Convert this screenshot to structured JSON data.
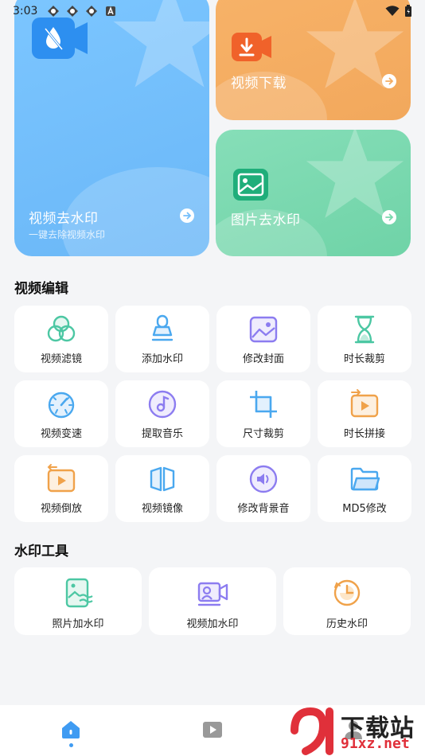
{
  "status_bar": {
    "time": "3:03"
  },
  "cards": {
    "video_remove": {
      "title": "视频去水印",
      "subtitle": "一键去除视频水印"
    },
    "video_download": {
      "title": "视频下载"
    },
    "image_remove": {
      "title": "图片去水印"
    }
  },
  "video_edit": {
    "title": "视频编辑",
    "items": [
      {
        "label": "视频滤镜",
        "icon": "filter-icon"
      },
      {
        "label": "添加水印",
        "icon": "stamp-icon"
      },
      {
        "label": "修改封面",
        "icon": "image-icon"
      },
      {
        "label": "时长裁剪",
        "icon": "hourglass-icon"
      },
      {
        "label": "视频变速",
        "icon": "speedometer-icon"
      },
      {
        "label": "提取音乐",
        "icon": "music-disc-icon"
      },
      {
        "label": "尺寸裁剪",
        "icon": "crop-icon"
      },
      {
        "label": "时长拼接",
        "icon": "video-join-icon"
      },
      {
        "label": "视频倒放",
        "icon": "video-reverse-icon"
      },
      {
        "label": "视频镜像",
        "icon": "mirror-icon"
      },
      {
        "label": "修改背景音",
        "icon": "volume-icon"
      },
      {
        "label": "MD5修改",
        "icon": "folder-icon"
      }
    ]
  },
  "watermark_tools": {
    "title": "水印工具",
    "items": [
      {
        "label": "照片加水印",
        "icon": "photo-watermark-icon"
      },
      {
        "label": "视频加水印",
        "icon": "video-watermark-icon"
      },
      {
        "label": "历史水印",
        "icon": "history-icon"
      }
    ]
  },
  "bottom_nav": {
    "items": [
      {
        "name": "home",
        "icon": "home-icon",
        "active": true
      },
      {
        "name": "video",
        "icon": "play-icon",
        "active": false
      },
      {
        "name": "profile",
        "icon": "user-icon",
        "active": false
      }
    ]
  },
  "watermark_logo": {
    "text": "下载站",
    "url": "91xz.net"
  },
  "colors": {
    "accent": "#3f9bf2",
    "card_blue": "#74bffb",
    "card_orange": "#f4ad62",
    "card_green": "#79d8ad",
    "icon_blue": "#4aa8ef",
    "icon_purple": "#8c7cf0",
    "icon_orange": "#f0a24a",
    "icon_green": "#4cc7a3"
  }
}
